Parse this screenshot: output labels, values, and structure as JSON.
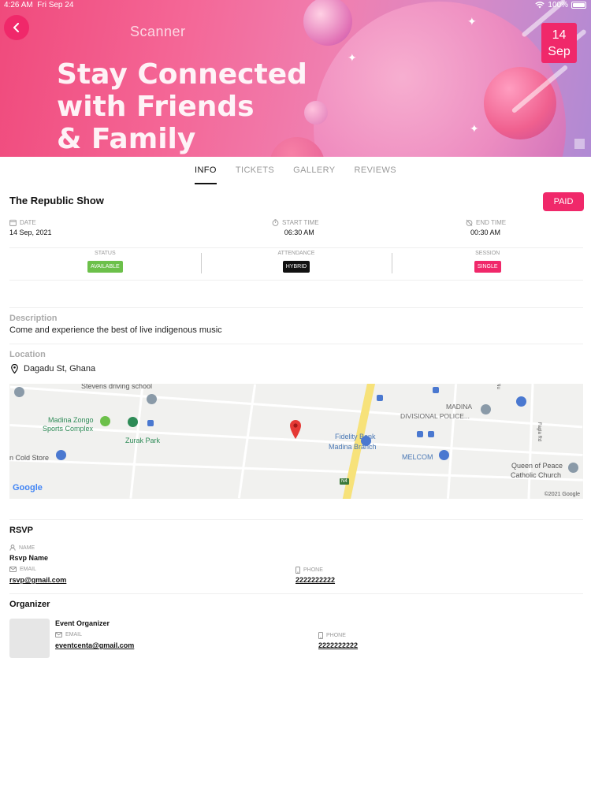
{
  "status_bar": {
    "time": "4:26 AM",
    "date": "Fri Sep 24",
    "battery": "100%"
  },
  "hero": {
    "kicker": "Scanner",
    "headline_lines": [
      "Stay Connected",
      "with Friends",
      "& Family"
    ],
    "date_day": "14",
    "date_month": "Sep"
  },
  "tabs": [
    {
      "label": "INFO",
      "active": true
    },
    {
      "label": "TICKETS",
      "active": false
    },
    {
      "label": "GALLERY",
      "active": false
    },
    {
      "label": "REVIEWS",
      "active": false
    }
  ],
  "event": {
    "title": "The Republic Show",
    "price_badge": "PAID",
    "date_label": "DATE",
    "date_value": "14 Sep, 2021",
    "start_label": "START TIME",
    "start_value": "06:30 AM",
    "end_label": "END TIME",
    "end_value": "00:30 AM"
  },
  "badges": [
    {
      "label": "STATUS",
      "value": "AVAILABLE",
      "color": "#6cc04a"
    },
    {
      "label": "ATTENDANCE",
      "value": "HYBRID",
      "color": "#111111"
    },
    {
      "label": "SESSION",
      "value": "SINGLE",
      "color": "#f0286a"
    }
  ],
  "description": {
    "label": "Description",
    "text": "Come and experience the best of live indigenous music"
  },
  "location": {
    "label": "Location",
    "address": "Dagadu St, Ghana",
    "map": {
      "labels": {
        "stevens": "Stevens driving school",
        "madina_zongo_1": "Madina Zongo",
        "madina_zongo_2": "Sports Complex",
        "zurak": "Zurak Park",
        "cold_store": "n Cold Store",
        "fidelity_1": "Fidelity Bank",
        "fidelity_2": "Madina Branch",
        "madina_div_1": "MADINA",
        "madina_div_2": "DIVISIONAL POLICE...",
        "melcom": "MELCOM",
        "queen_1": "Queen of Peace",
        "queen_2": "Catholic Church",
        "fagla": "Fagla Rd",
        "nu": "Nu",
        "n4": "N4"
      },
      "google": "Google",
      "copyright": "©2021 Google"
    }
  },
  "rsvp": {
    "title": "RSVP",
    "name_label": "NAME",
    "name_value": "Rsvp Name",
    "email_label": "EMAIL",
    "email_value": "rsvp@gmail.com",
    "phone_label": "PHONE",
    "phone_value": "2222222222"
  },
  "organizer": {
    "title": "Organizer",
    "name": "Event Organizer",
    "email_label": "EMAIL",
    "email_value": "eventcenta@gmail.com",
    "phone_label": "PHONE",
    "phone_value": "2222222222"
  }
}
